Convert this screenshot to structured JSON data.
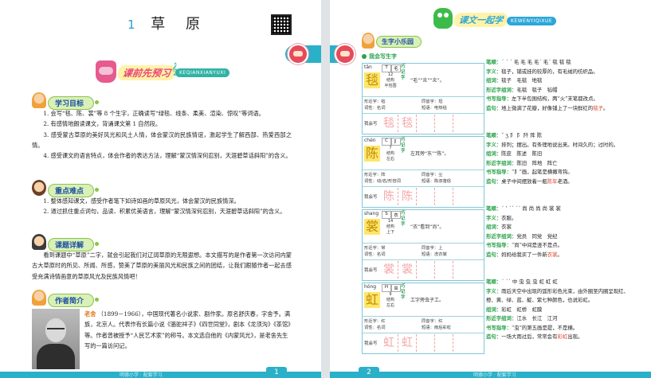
{
  "left": {
    "lesson_num": "1",
    "lesson_title": "草 原",
    "banner_word": "课前先预习",
    "banner_en": "KEQIANXIANYUXI",
    "sections": [
      {
        "title": "学习目标",
        "lines": [
          "1. 会写“毯、陈、裳”等 8 个生字，正确读写“绿毯、线条、柔美、渲染、惊叹”等词语。",
          "2. 有感情地朗读课文，背诵课文第 1 自然段。",
          "3. 感受蒙古草原的美好风光和风土人情，体会蒙汉的民族情谊，激起学生了解西部、热爱西部之情。",
          "4. 感受课文的语言特点，体会作者的表达方法，理解“蒙汉情深何忍别，天涯碧草话斜阳”的含义。"
        ]
      },
      {
        "title": "重点难点",
        "lines": [
          "1. 整体感知课文，感受作者笔下如诗如画的草原风光，体会蒙汉的民族情深。",
          "2. 通过抓住重点词句，品读、积累优美语言，理解“蒙汉情深何忍别，天涯碧草话斜阳”的含义。"
        ]
      },
      {
        "title": "课题详解",
        "lines": [
          "看到课题中“草原”二字，就会引起我们对辽阔草原的无限遐想。本文描写的是作者第一次访问内蒙古大草原时的所见、所闻、所感，赞美了草原的美丽风光和民族之间的团结，让我们跟随作者一起去感受充满诗情画意的草原风光及民族风情吧！"
        ]
      },
      {
        "title": "作者简介",
        "author_name": "老舍",
        "author_text": "（1899－1966），中国现代著名小说家、剧作家。原名舒庆春，字舍予。满族，北京人。代表作有长篇小说《骆驼祥子》《四世同堂》，剧本《龙须沟》《茶馆》等。作者曾被授予“人民艺术家”的称号。本文选自他的《内蒙风光》，是老舍先生写的一篇访问记。"
      }
    ],
    "page_number": "1",
    "footer_text": "明德小学 · 配套学习"
  },
  "right": {
    "banner_word": "课文一起学",
    "banner_en": "KEWENYIQIXUE",
    "sub_title": "生字小乐园",
    "sub_section": "我会写生字",
    "cards": [
      {
        "pinyin": "tǎn",
        "tone_box": "T",
        "radical_box": "毛",
        "char": "毯",
        "meta": "12\n结构\n半包围",
        "tip": "巧记字",
        "hint": "“毛”“炎”“炎”。",
        "xs": "形近字：毡\n词性：名词",
        "ty": "同音字：坦\n短语：电热毯",
        "write": [
          "毯",
          "毯",
          "",
          ""
        ]
      },
      {
        "pinyin": "chén",
        "tone_box": "C",
        "radical_box": "阝",
        "char": "陈",
        "meta": "7\n结构\n左右",
        "tip": "巧记字",
        "hint": "左耳旁“东”“陈”。",
        "xs": "形近字：阵\n词性：动/名/形容词",
        "ty": "同音字：尘\n短语：陈旧落俗",
        "write": [
          "陈",
          "陈",
          "",
          ""
        ]
      },
      {
        "pinyin": "shang",
        "tone_box": "S",
        "radical_box": "衣",
        "char": "裳",
        "meta": "14\n结构\n上下",
        "tip": "巧记字",
        "hint": "“衣”看到“尚”。",
        "xs": "形近字：常\n词性：名词",
        "ty": "同音字：上\n短语：洗衣裳",
        "write": [
          "裳",
          "裳",
          "",
          ""
        ]
      },
      {
        "pinyin": "hóng",
        "tone_box": "H",
        "radical_box": "虫",
        "char": "虹",
        "meta": "9\n结构\n左右",
        "tip": "巧记字",
        "hint": "工字旁虫子工。",
        "xs": "形近字：红\n词性：名词",
        "ty": "同音字：红\n短语：雨后彩虹",
        "write": [
          "虹",
          "虹",
          "",
          ""
        ]
      }
    ],
    "notes": [
      [
        {
          "k": "笔顺：",
          "t": "ˊ ˊ ˊ 毛 毛 毛 毛ˊ 毛ˊ 毯 毯 毯"
        },
        {
          "k": "字义：",
          "t": "毯子，铺或挂的较厚的，有毛绒的纺织品。"
        },
        {
          "k": "组词：",
          "t": "毯子　毛毯　地毯"
        },
        {
          "k": "形近字组词：",
          "t": "毛毯　毯子　毡帽"
        },
        {
          "k": "书写指导：",
          "t": "左下半包围结构，两“火”末笔都改点。"
        },
        {
          "k": "造句：",
          "t": "地上微满了花瓣，好像铺上了一块鲜红的",
          "hl": "毯子",
          "end": "。"
        }
      ],
      [
        {
          "k": "笔顺：",
          "t": "ˇ ʒ 阝 阝 阡 阵 陈"
        },
        {
          "k": "字义：",
          "t": "排列；摆出。有条理地说出来。时间久的；过时的。"
        },
        {
          "k": "组词：",
          "t": "陈皮　陈述　陈旧"
        },
        {
          "k": "形近字组词：",
          "t": "陈旧　阵地　阵亡"
        },
        {
          "k": "书写指导：",
          "t": "“阝”画，起笔是横撇弯钩。"
        },
        {
          "k": "造句：",
          "t": "桌子中间摆放着一瓶",
          "hl": "陈年",
          "end": "老酒。"
        }
      ],
      [
        {
          "k": "笔顺：",
          "t": "ˊ ʼ ˊˊ ˊˊ 尚 尚 尚 尚 裳 裳"
        },
        {
          "k": "字义：",
          "t": "衣服。"
        },
        {
          "k": "组词：",
          "t": "衣裳"
        },
        {
          "k": "形近字组词：",
          "t": "党员　同党　党纪"
        },
        {
          "k": "书写指导：",
          "t": "“尚”中间是竖不是点。"
        },
        {
          "k": "造句：",
          "t": "妈妈给我买了一件新",
          "hl": "衣裳",
          "end": "。"
        }
      ],
      [
        {
          "k": "笔顺：",
          "t": "ˊ ˊˊ 中 虫 虫 虫 虹 虹 虹"
        },
        {
          "k": "字义：",
          "t": "雨后天空中出现的弧形彩色光束，由外圈至内圈呈现红、橙、黄、绿、蓝、靛、紫七种颜色，也说彩虹。"
        },
        {
          "k": "组词：",
          "t": "彩虹　虹桥　虹膜"
        },
        {
          "k": "形近字组词：",
          "t": "江水　长江　江河"
        },
        {
          "k": "书写指导：",
          "t": "“虫”的第五画是提，不是横。"
        },
        {
          "k": "造句：",
          "t": "一场大雨过后，常常会有",
          "hl": "彩虹",
          "end": "出现。"
        }
      ]
    ],
    "page_number": "2",
    "footer_text": "明德小学 · 配套学习"
  },
  "colors": {
    "accent": "#2ab0c8",
    "green": "#2aa24b",
    "blue": "#1b4fa1",
    "highlight": "#ffe66b"
  }
}
